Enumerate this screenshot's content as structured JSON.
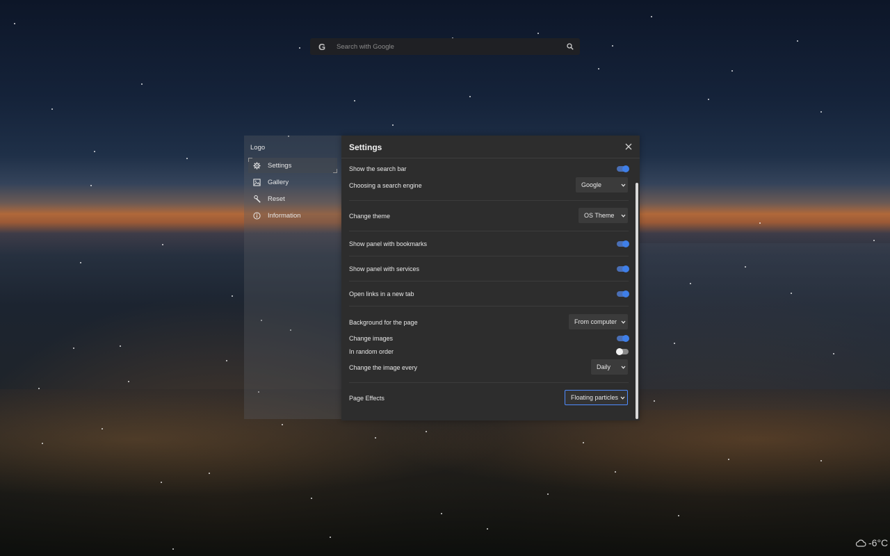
{
  "search": {
    "placeholder": "Search with Google",
    "engine_icon": "google-g-icon",
    "search_icon": "magnifier-icon"
  },
  "sidebar": {
    "logo": "Logo",
    "items": [
      {
        "label": "Settings",
        "icon": "gear-icon",
        "active": true
      },
      {
        "label": "Gallery",
        "icon": "image-icon",
        "active": false
      },
      {
        "label": "Reset",
        "icon": "wrench-icon",
        "active": false
      },
      {
        "label": "Information",
        "icon": "info-icon",
        "active": false
      }
    ]
  },
  "settings": {
    "title": "Settings",
    "close_icon": "close-icon",
    "rows": {
      "show_search_bar": {
        "label": "Show the search bar",
        "value": true
      },
      "search_engine": {
        "label": "Choosing a search engine",
        "value": "Google"
      },
      "theme": {
        "label": "Change theme",
        "value": "OS Theme"
      },
      "bookmarks_panel": {
        "label": "Show panel with bookmarks",
        "value": true
      },
      "services_panel": {
        "label": "Show panel with services",
        "value": true
      },
      "new_tab_links": {
        "label": "Open links in a new tab",
        "value": true
      },
      "background": {
        "label": "Background for the page",
        "value": "From computer"
      },
      "change_images": {
        "label": "Change images",
        "value": true
      },
      "random_order": {
        "label": "In random order",
        "value": false
      },
      "change_interval": {
        "label": "Change the image every",
        "value": "Daily"
      },
      "page_effects": {
        "label": "Page Effects",
        "value": "Floating particles"
      }
    }
  },
  "weather": {
    "icon": "cloud-icon",
    "temperature": "-6°C"
  },
  "colors": {
    "accent": "#3f7fe8",
    "panel_bg": "#2d2d2d",
    "focus_border": "#4f8cff"
  }
}
